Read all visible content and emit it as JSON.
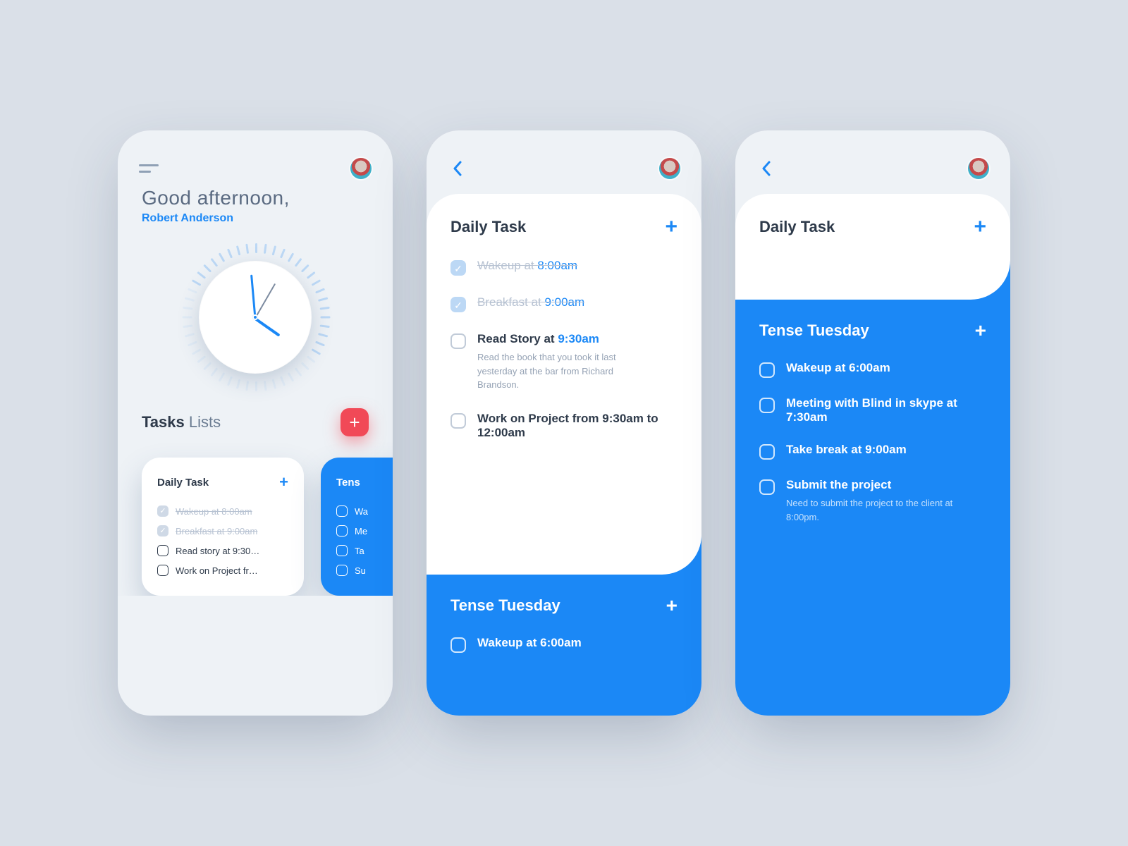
{
  "colors": {
    "accent": "#1b88f6",
    "danger": "#f14957"
  },
  "screen1": {
    "greeting": "Good afternoon,",
    "user_name": "Robert Anderson",
    "section_title_strong": "Tasks",
    "section_title_rest": " Lists",
    "cards": [
      {
        "title": "Daily Task",
        "items": [
          {
            "text": "Wakeup at 8:00am",
            "done": true
          },
          {
            "text": "Breakfast at 9:00am",
            "done": true
          },
          {
            "text": "Read story at 9:30…",
            "done": false
          },
          {
            "text": "Work on Project fr…",
            "done": false
          }
        ]
      },
      {
        "title": "Tens",
        "items": [
          {
            "text": "Wa",
            "done": false
          },
          {
            "text": "Me",
            "done": false
          },
          {
            "text": "Ta",
            "done": false
          },
          {
            "text": "Su",
            "done": false
          }
        ]
      }
    ]
  },
  "screen2": {
    "panel_title": "Daily Task",
    "tasks": [
      {
        "text": "Wakeup at ",
        "time": "8:00am",
        "done": true
      },
      {
        "text": "Breakfast at ",
        "time": "9:00am",
        "done": true
      },
      {
        "text": "Read Story at ",
        "time": "9:30am",
        "done": false,
        "desc": "Read the book that you took it last yesterday at the bar from Richard Brandson."
      },
      {
        "text": "Work on Project from 9:30am to 12:00am",
        "time": "",
        "done": false
      }
    ],
    "next_panel_title": "Tense Tuesday",
    "next_panel_tasks": [
      {
        "text": "Wakeup at 6:00am"
      }
    ]
  },
  "screen3": {
    "panel_title": "Daily Task",
    "blue_title": "Tense Tuesday",
    "tasks": [
      {
        "text": "Wakeup at 6:00am"
      },
      {
        "text": "Meeting with Blind in skype at 7:30am"
      },
      {
        "text": "Take break at 9:00am"
      },
      {
        "text": "Submit the project",
        "desc": "Need to submit the project to the client at 8:00pm."
      }
    ]
  }
}
